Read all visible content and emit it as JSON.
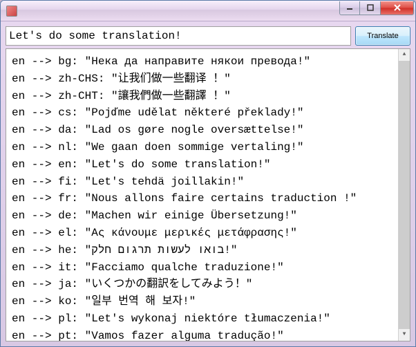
{
  "window": {
    "title": ""
  },
  "input": {
    "value": "Let's do some translation!"
  },
  "buttons": {
    "translate": "Translate"
  },
  "translations": [
    {
      "from": "en",
      "to": "bg",
      "text": "Нека да направите някои превода!"
    },
    {
      "from": "en",
      "to": "zh-CHS",
      "text": "让我们做一些翻译 ！"
    },
    {
      "from": "en",
      "to": "zh-CHT",
      "text": "讓我們做一些翻譯 ！"
    },
    {
      "from": "en",
      "to": "cs",
      "text": "Pojďme udělat některé překlady!"
    },
    {
      "from": "en",
      "to": "da",
      "text": "Lad os gøre nogle oversættelse!"
    },
    {
      "from": "en",
      "to": "nl",
      "text": "We gaan doen sommige vertaling!"
    },
    {
      "from": "en",
      "to": "en",
      "text": "Let's do some translation!"
    },
    {
      "from": "en",
      "to": "fi",
      "text": "Let's tehdä joillakin!"
    },
    {
      "from": "en",
      "to": "fr",
      "text": "Nous allons faire certains traduction !"
    },
    {
      "from": "en",
      "to": "de",
      "text": "Machen wir einige Übersetzung!"
    },
    {
      "from": "en",
      "to": "el",
      "text": "Ας κάνουμε μερικές μετάφρασης!"
    },
    {
      "from": "en",
      "to": "he",
      "text": "בואו לעשות תרגום חלק!"
    },
    {
      "from": "en",
      "to": "it",
      "text": "Facciamo qualche traduzione!"
    },
    {
      "from": "en",
      "to": "ja",
      "text": "いくつかの翻訳をしてみよう！"
    },
    {
      "from": "en",
      "to": "ko",
      "text": "일부 번역 해 보자!"
    },
    {
      "from": "en",
      "to": "pl",
      "text": "Let's wykonaj niektóre tłumaczenia!"
    },
    {
      "from": "en",
      "to": "pt",
      "text": "Vamos fazer alguma tradução!"
    }
  ]
}
